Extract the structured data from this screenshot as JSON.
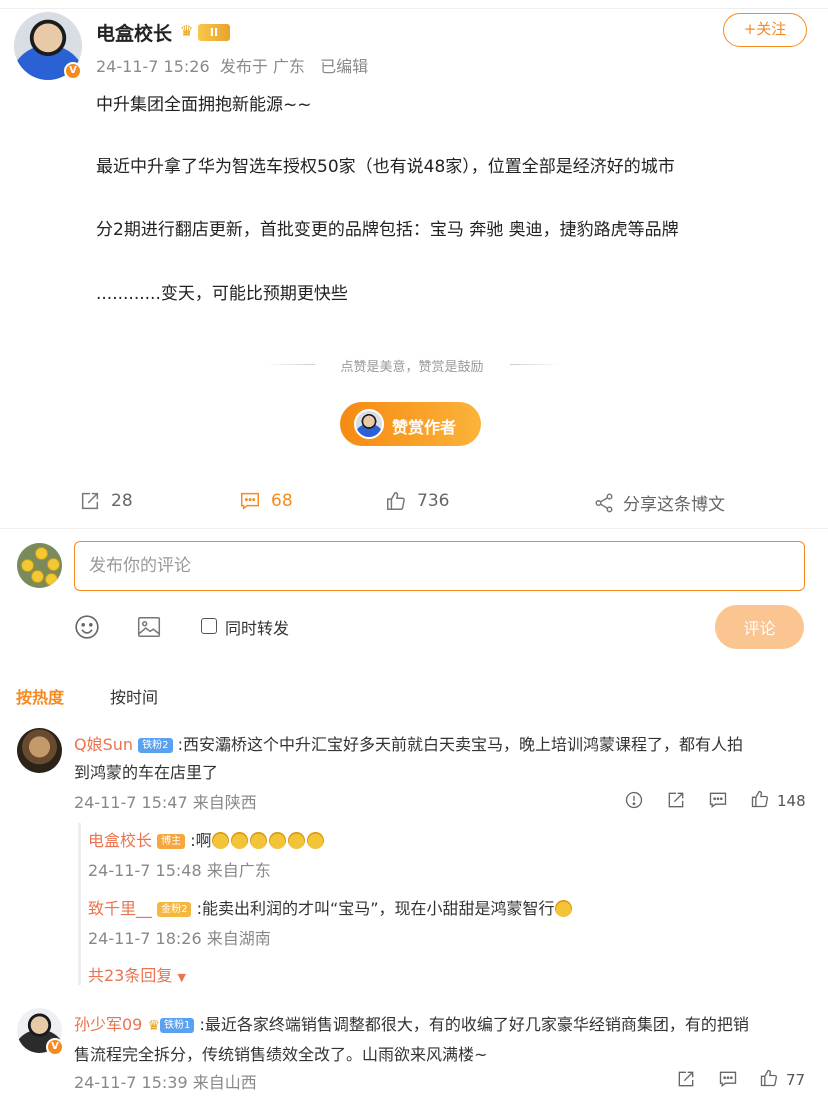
{
  "post": {
    "author": "电盒校长",
    "vip_level": "II",
    "time": "24-11-7 15:26",
    "source": "发布于 广东",
    "edited": "已编辑",
    "follow_label": "+关注",
    "lines": [
      "中升集团全面拥抱新能源~~",
      "最近中升拿了华为智选车授权50家（也有说48家），位置全部是经济好的城市",
      "分2期进行翻店更新，首批变更的品牌包括：宝马 奔驰 奥迪，捷豹路虎等品牌",
      "............变天，可能比预期更快些"
    ],
    "reward_hint": "点赞是美意，赞赏是鼓励",
    "reward_label": "赞赏作者",
    "stats": {
      "repost": "28",
      "comments": "68",
      "likes": "736",
      "share": "分享这条博文"
    }
  },
  "composer": {
    "placeholder": "发布你的评论",
    "repost_label": "同时转发",
    "submit_label": "评论"
  },
  "sort": {
    "hot": "按热度",
    "time": "按时间"
  },
  "comments": [
    {
      "name": "Q娘Sun",
      "badge": "铁粉2",
      "line1": ":西安灞桥这个中升汇宝好多天前就白天卖宝马，晚上培训鸿蒙课程了，都有人拍",
      "line2": "到鸿蒙的车在店里了",
      "meta": "24-11-7 15:47 来自陕西",
      "likes": "148"
    },
    {
      "name": "孙少军09",
      "badge": "铁粉1",
      "line1": ":最近各家终端销售调整都很大，有的收编了好几家豪华经销商集团，有的把销",
      "line2": "售流程完全拆分，传统销售绩效全改了。山雨欲来风满楼~",
      "meta": "24-11-7 15:39 来自山西",
      "likes": "77"
    }
  ],
  "replies": [
    {
      "name": "电盒校长",
      "badge": "博主",
      "text": ":啊",
      "meta": "24-11-7 15:48 来自广东"
    },
    {
      "name": "致千里__",
      "badge": "金粉2",
      "text": ":能卖出利润的才叫“宝马”，现在小甜甜是鸿蒙智行",
      "meta": "24-11-7 18:26 来自湖南"
    }
  ],
  "more_replies": "共23条回复",
  "colors": {
    "accent": "#f78a1d",
    "name": "#eb7350"
  }
}
